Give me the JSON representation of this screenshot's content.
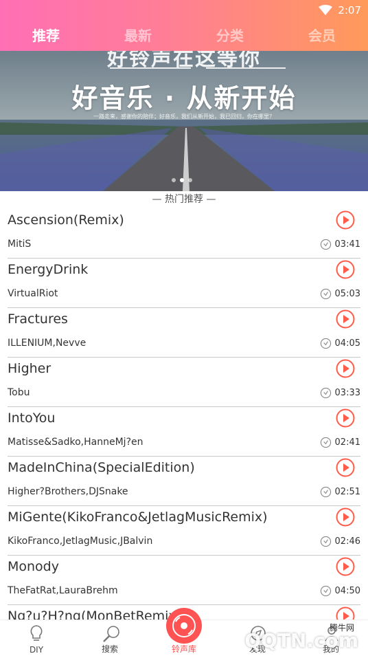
{
  "status_bar": {
    "time": "2:07"
  },
  "tabs": [
    {
      "label": "推荐",
      "active": true
    },
    {
      "label": "最新"
    },
    {
      "label": "分类"
    },
    {
      "label": "会员"
    }
  ],
  "banner": {
    "text_top": "好铃声在这等你",
    "text_main": "好音乐 · 从新开始",
    "text_small": "一路走来，感谢你的陪伴；好音乐，我们从新开始，我已回归，你在哪里？"
  },
  "section_title": "— 热门推荐 —",
  "songs": [
    {
      "title": "Ascension(Remix)",
      "artist": "MitiS",
      "duration": "03:41"
    },
    {
      "title": "EnergyDrink",
      "artist": "VirtualRiot",
      "duration": "05:03"
    },
    {
      "title": "Fractures",
      "artist": "ILLENIUM,Nevve",
      "duration": "04:05"
    },
    {
      "title": "Higher",
      "artist": "Tobu",
      "duration": "03:33"
    },
    {
      "title": "IntoYou",
      "artist": "Matisse&Sadko,HanneMj?en",
      "duration": "02:41"
    },
    {
      "title": "MadeInChina(SpecialEdition)",
      "artist": "Higher?Brothers,DJSnake",
      "duration": "02:51"
    },
    {
      "title": "MiGente(KikoFranco&JetlagMusicRemix)",
      "artist": "KikoFranco,JetlagMusic,JBalvin",
      "duration": "02:46"
    },
    {
      "title": "Monody",
      "artist": "TheFatRat,LauraBrehm",
      "duration": "04:50"
    },
    {
      "title": "Ng?u?H?ng(MonBetRemix)",
      "artist": "",
      "duration": ""
    }
  ],
  "bottom_nav": [
    {
      "label": "DIY"
    },
    {
      "label": "搜索"
    },
    {
      "label": "铃声库",
      "active": true
    },
    {
      "label": "发现"
    },
    {
      "label": "我的"
    }
  ],
  "watermark": {
    "text": "QQTN.com",
    "small": "腾牛网"
  },
  "colors": {
    "accent": "#ff4a4a",
    "header_start": "#ff6fb5",
    "header_end": "#ff9a5a"
  }
}
